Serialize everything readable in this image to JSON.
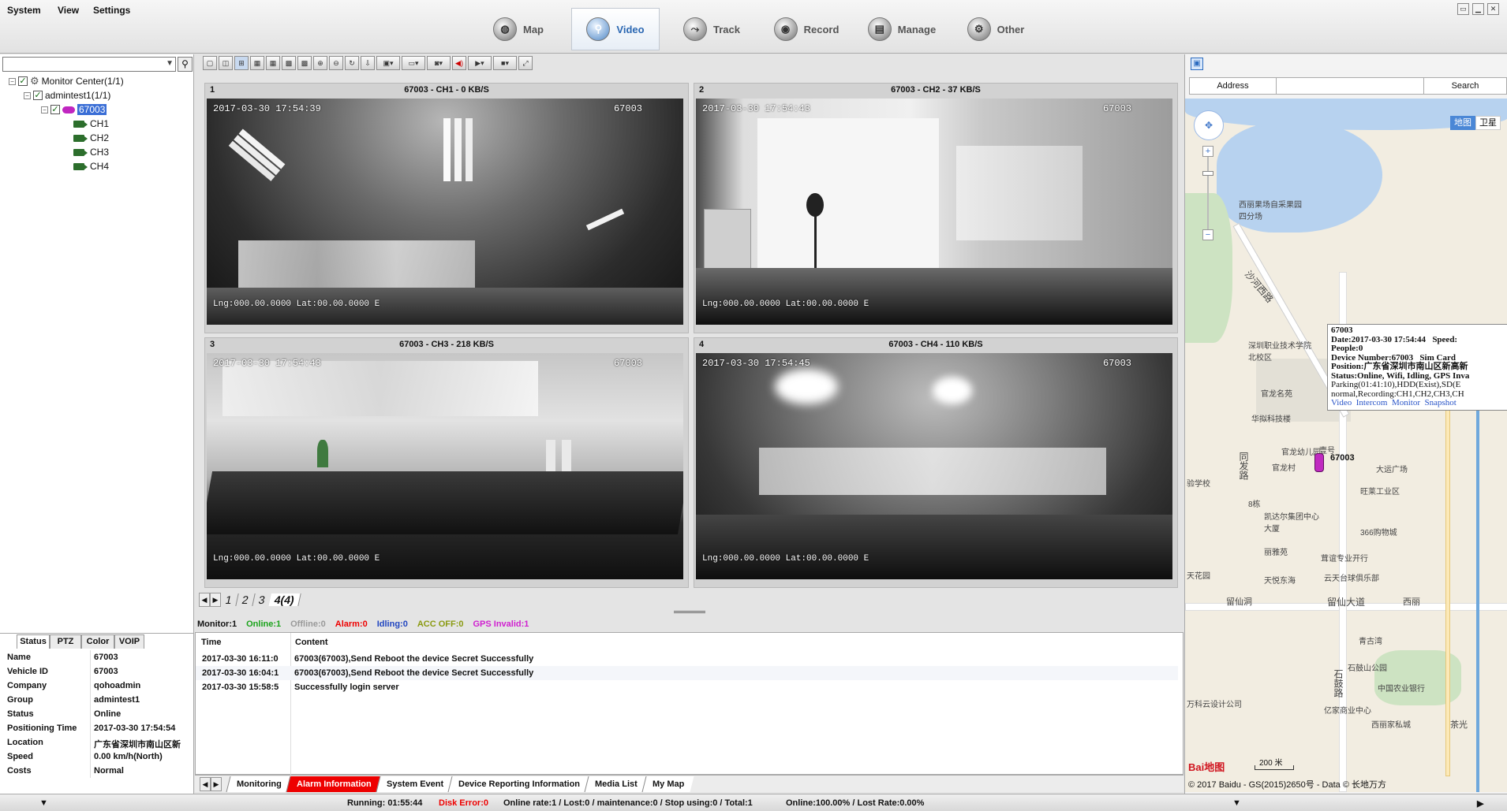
{
  "menu": {
    "system": "System",
    "view": "View",
    "settings": "Settings"
  },
  "nav": [
    {
      "label": "Map",
      "icon": "map-icon"
    },
    {
      "label": "Video",
      "icon": "video-icon",
      "active": true
    },
    {
      "label": "Track",
      "icon": "track-icon"
    },
    {
      "label": "Record",
      "icon": "record-icon"
    },
    {
      "label": "Manage",
      "icon": "manage-icon"
    },
    {
      "label": "Other",
      "icon": "other-icon"
    }
  ],
  "tree": {
    "root": "Monitor Center(1/1)",
    "group": "admintest1(1/1)",
    "device": "67003",
    "channels": [
      "CH1",
      "CH2",
      "CH3",
      "CH4"
    ]
  },
  "status_tabs": [
    "Status",
    "PTZ",
    "Color",
    "VOIP"
  ],
  "status": [
    {
      "key": "Name",
      "value": "67003"
    },
    {
      "key": "Vehicle ID",
      "value": "67003"
    },
    {
      "key": "Company",
      "value": "qohoadmin"
    },
    {
      "key": "Group",
      "value": "admintest1"
    },
    {
      "key": "Status",
      "value": "Online"
    },
    {
      "key": "Positioning Time",
      "value": "2017-03-30 17:54:54"
    },
    {
      "key": "Location",
      "value": "广东省深圳市南山区新"
    },
    {
      "key": "Speed",
      "value": "0.00 km/h(North)"
    },
    {
      "key": "Costs",
      "value": "Normal"
    }
  ],
  "videos": [
    {
      "num": "1",
      "title": "67003 - CH1 - 0 KB/S",
      "timestamp": "2017-03-30 17:54:39",
      "device": "67003",
      "gps": "Lng:000.00.0000 Lat:00.00.0000 E"
    },
    {
      "num": "2",
      "title": "67003 - CH2 - 37 KB/S",
      "timestamp": "2017-03-30 17:54:43",
      "device": "67003",
      "gps": "Lng:000.00.0000 Lat:00.00.0000 E"
    },
    {
      "num": "3",
      "title": "67003 - CH3 - 218 KB/S",
      "timestamp": "2017-03-30 17:54:43",
      "device": "67003",
      "gps": "Lng:000.00.0000 Lat:00.00.0000 E"
    },
    {
      "num": "4",
      "title": "67003 - CH4 - 110 KB/S",
      "timestamp": "2017-03-30 17:54:45",
      "device": "67003",
      "gps": "Lng:000.00.0000 Lat:00.00.0000 E"
    }
  ],
  "pages": [
    "1",
    "2",
    "3",
    "4(4)"
  ],
  "monitor_stats": {
    "monitor": "Monitor:1",
    "online": "Online:1",
    "offline": "Offline:0",
    "alarm": "Alarm:0",
    "idling": "Idling:0",
    "acc_off": "ACC OFF:0",
    "gps_invalid": "GPS Invalid:1"
  },
  "log": {
    "headers": {
      "time": "Time",
      "content": "Content"
    },
    "rows": [
      {
        "time": "2017-03-30 16:11:0",
        "content": "67003(67003),Send Reboot the device Secret Successfully"
      },
      {
        "time": "2017-03-30 16:04:1",
        "content": "67003(67003),Send Reboot the device Secret Successfully"
      },
      {
        "time": "2017-03-30 15:58:5",
        "content": "Successfully login server"
      }
    ]
  },
  "bottom_tabs": [
    "Monitoring",
    "Alarm Information",
    "System Event",
    "Device Reporting Information",
    "Media List",
    "My Map"
  ],
  "map": {
    "address_label": "Address",
    "search_label": "Search",
    "map_type": "地图",
    "satellite": "卫星",
    "popup": {
      "id": "67003",
      "date": "Date:2017-03-30 17:54:44",
      "speed": "Speed:",
      "people": "People:0",
      "device_number": "Device Number:67003",
      "sim": "Sim Card",
      "position": "Position:广东省深圳市南山区新高新",
      "status": "Status:Online, Wifi, Idling, GPS Inva",
      "parking": "Parking(01:41:10),HDD(Exist),SD(E",
      "recording": "normal,Recording:CH1,CH2,CH3,CH",
      "links": [
        "Video",
        "Intercom",
        "Monitor",
        "Snapshot"
      ]
    },
    "vehicle_label": "67003",
    "scale": "200 米",
    "copyright": "© 2017 Baidu - GS(2015)2650号 - Data © 长地万方",
    "logo": "Bai地图",
    "places": [
      "西丽果场自采果园四分场",
      "沙河西路",
      "深圳职业技术学院北校区",
      "官龙名苑",
      "华拟科技楼",
      "官龙幼儿园",
      "官龙村",
      "大运广场",
      "旺莱工业区",
      "凯达尔集团中心大厦",
      "366购物城",
      "丽雅苑",
      "茸谊专业开行",
      "天悦东海",
      "云天台球俱乐部",
      "留仙洞",
      "留仙大道",
      "西丽",
      "青古湾",
      "石鼓山公园",
      "中国农业银行",
      "石鼓路",
      "万科云设计公司",
      "亿家商业中心",
      "西丽家私城",
      "茶光",
      "同发路",
      "8栋",
      "验学校",
      "天花园",
      "壹号"
    ]
  },
  "footer": {
    "running": "Running: 01:55:44",
    "disk_error": "Disk Error:0",
    "rates": "Online rate:1 / Lost:0 / maintenance:0 / Stop using:0 / Total:1",
    "online_pct": "Online:100.00% / Lost Rate:0.00%"
  }
}
